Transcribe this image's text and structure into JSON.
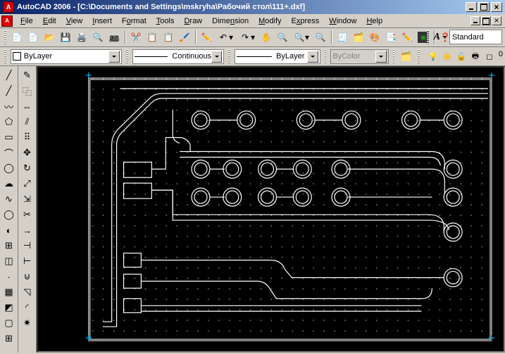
{
  "title": "AutoCAD 2006 - [C:\\Documents and Settings\\mskryha\\Рабочий стол\\111+.dxf]",
  "menubar": {
    "items": [
      "File",
      "Edit",
      "View",
      "Insert",
      "Format",
      "Tools",
      "Draw",
      "Dimension",
      "Modify",
      "Express",
      "Window",
      "Help"
    ]
  },
  "properties": {
    "layer_combo": "ByLayer",
    "linetype_combo": "Continuous",
    "lineweight_combo": "ByLayer",
    "color_combo": "ByColor",
    "style_combo": "Standard",
    "layer_index": "0"
  },
  "chart_data": {
    "type": "other",
    "title": "PCB layout drawing",
    "note": "Vector CAD drawing of a printed-circuit board outline with routed traces and pads on a black drawing area; numeric data not applicable."
  }
}
